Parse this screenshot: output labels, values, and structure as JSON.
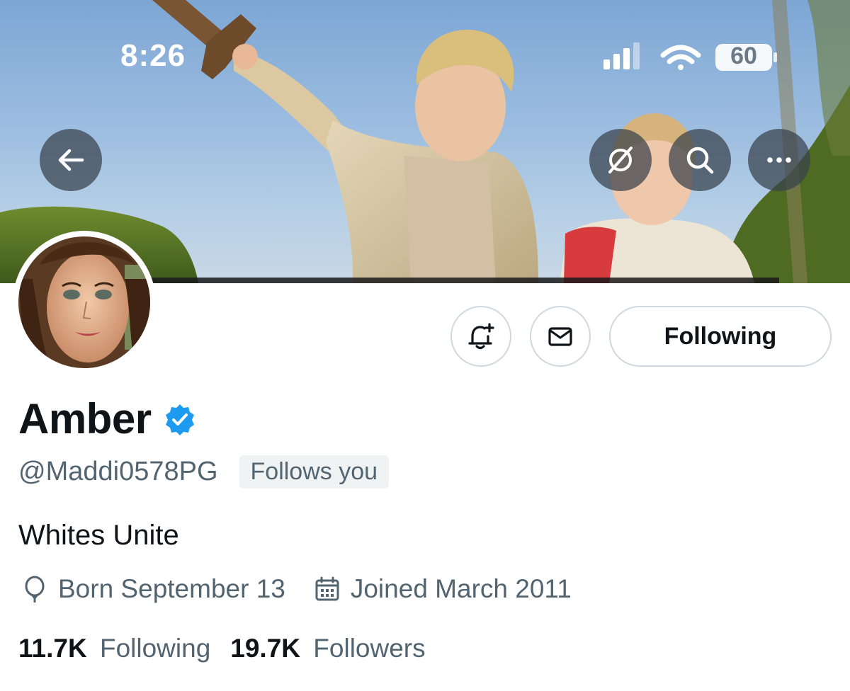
{
  "status_bar": {
    "time": "8:26",
    "battery": "60"
  },
  "header_buttons": {
    "back": "back-arrow-icon",
    "grok": "grok-icon",
    "search": "search-icon",
    "more": "more-horizontal-icon"
  },
  "actions": {
    "notifications": "bell-plus-icon",
    "message": "envelope-icon",
    "follow_label": "Following"
  },
  "profile": {
    "name": "Amber",
    "verified": true,
    "handle": "@Maddi0578PG",
    "follows_you": "Follows you",
    "bio": "Whites Unite",
    "born": "Born September 13",
    "joined": "Joined March 2011",
    "following_count": "11.7K",
    "following_label": "Following",
    "followers_count": "19.7K",
    "followers_label": "Followers"
  },
  "colors": {
    "primary_text": "#0f1419",
    "secondary_text": "#536471",
    "verified_blue": "#1d9bf0",
    "border": "#cfd9de",
    "chip_bg": "#eff3f4"
  }
}
